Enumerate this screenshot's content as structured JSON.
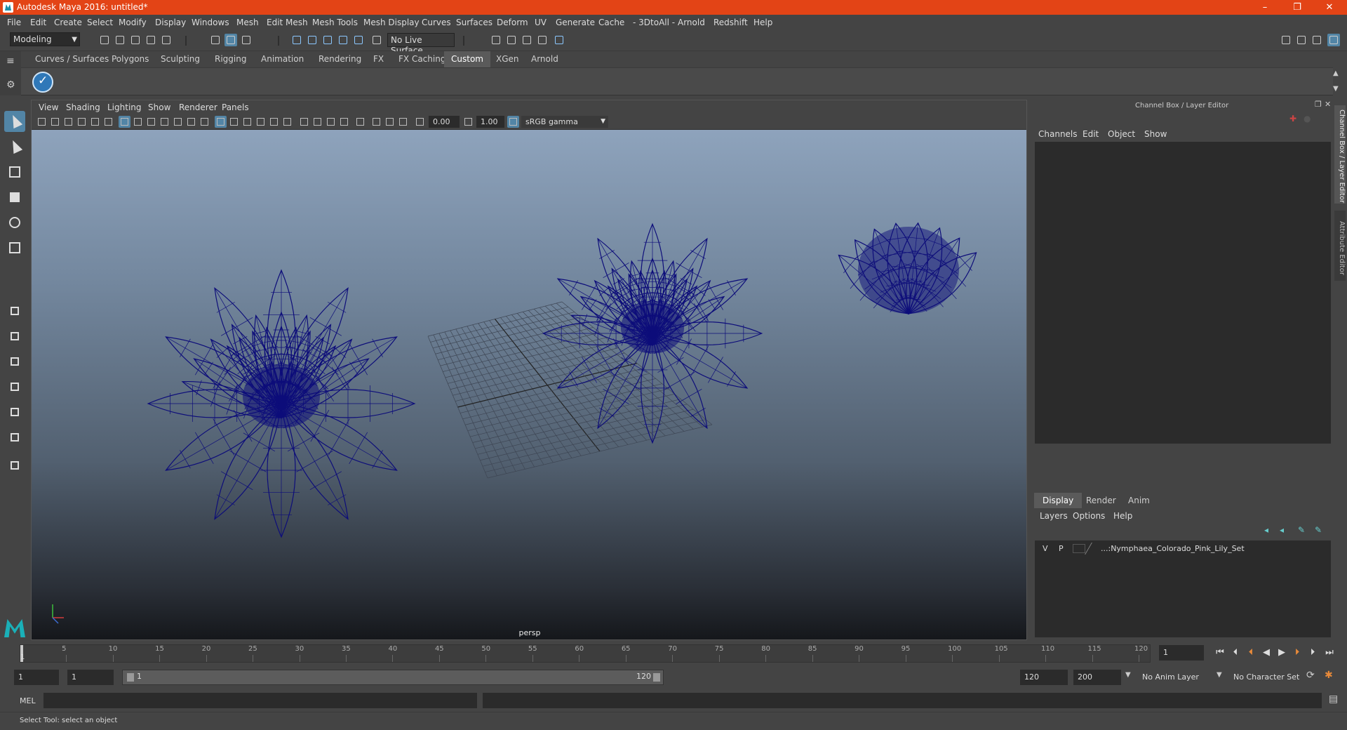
{
  "titlebar": {
    "title": "Autodesk Maya 2016: untitled*",
    "minimize": "–",
    "restore": "❐",
    "close": "✕"
  },
  "menus": [
    "File",
    "Edit",
    "Create",
    "Select",
    "Modify",
    "Display",
    "Windows",
    "Mesh",
    "Edit Mesh",
    "Mesh Tools",
    "Mesh Display",
    "Curves",
    "Surfaces",
    "Deform",
    "UV",
    "Generate",
    "Cache",
    "- 3DtoAll -",
    "Arnold",
    "Redshift",
    "Help"
  ],
  "status": {
    "mode": "Modeling",
    "live_surface": "No Live Surface"
  },
  "shelf": {
    "tabs": [
      "Curves / Surfaces",
      "Polygons",
      "Sculpting",
      "Rigging",
      "Animation",
      "Rendering",
      "FX",
      "FX Caching",
      "Custom",
      "XGen",
      "Arnold"
    ],
    "active_tab": "Custom",
    "tool_icon": "check-circle-icon"
  },
  "viewport": {
    "menus": [
      "View",
      "Shading",
      "Lighting",
      "Show",
      "Renderer",
      "Panels"
    ],
    "exposure": "0.00",
    "gamma": "1.00",
    "color_space": "sRGB gamma",
    "camera_label": "persp",
    "wire_color": "#0d0d7a"
  },
  "channelbox": {
    "title": "Channel Box / Layer Editor",
    "menus": [
      "Channels",
      "Edit",
      "Object",
      "Show"
    ],
    "layer_tabs": [
      "Display",
      "Render",
      "Anim"
    ],
    "active_layer_tab": "Display",
    "layer_menus": [
      "Layers",
      "Options",
      "Help"
    ],
    "layer": {
      "v": "V",
      "p": "P",
      "name": "...:Nymphaea_Colorado_Pink_Lily_Set"
    },
    "side_tabs": [
      "Channel Box / Layer Editor",
      "Attribute Editor"
    ]
  },
  "timeline": {
    "ticks": [
      "5",
      "10",
      "15",
      "20",
      "25",
      "30",
      "35",
      "40",
      "45",
      "50",
      "55",
      "60",
      "65",
      "70",
      "75",
      "80",
      "85",
      "90",
      "95",
      "100",
      "105",
      "110",
      "115",
      "120"
    ],
    "start_label": "1",
    "current_frame": "1"
  },
  "range": {
    "start": "1",
    "playback_start": "1",
    "bar_start": "1",
    "bar_end": "120",
    "playback_end": "120",
    "end": "200",
    "anim_layer": "No Anim Layer",
    "character_set": "No Character Set"
  },
  "cmdline": {
    "label": "MEL"
  },
  "help": {
    "text": "Select Tool: select an object"
  }
}
